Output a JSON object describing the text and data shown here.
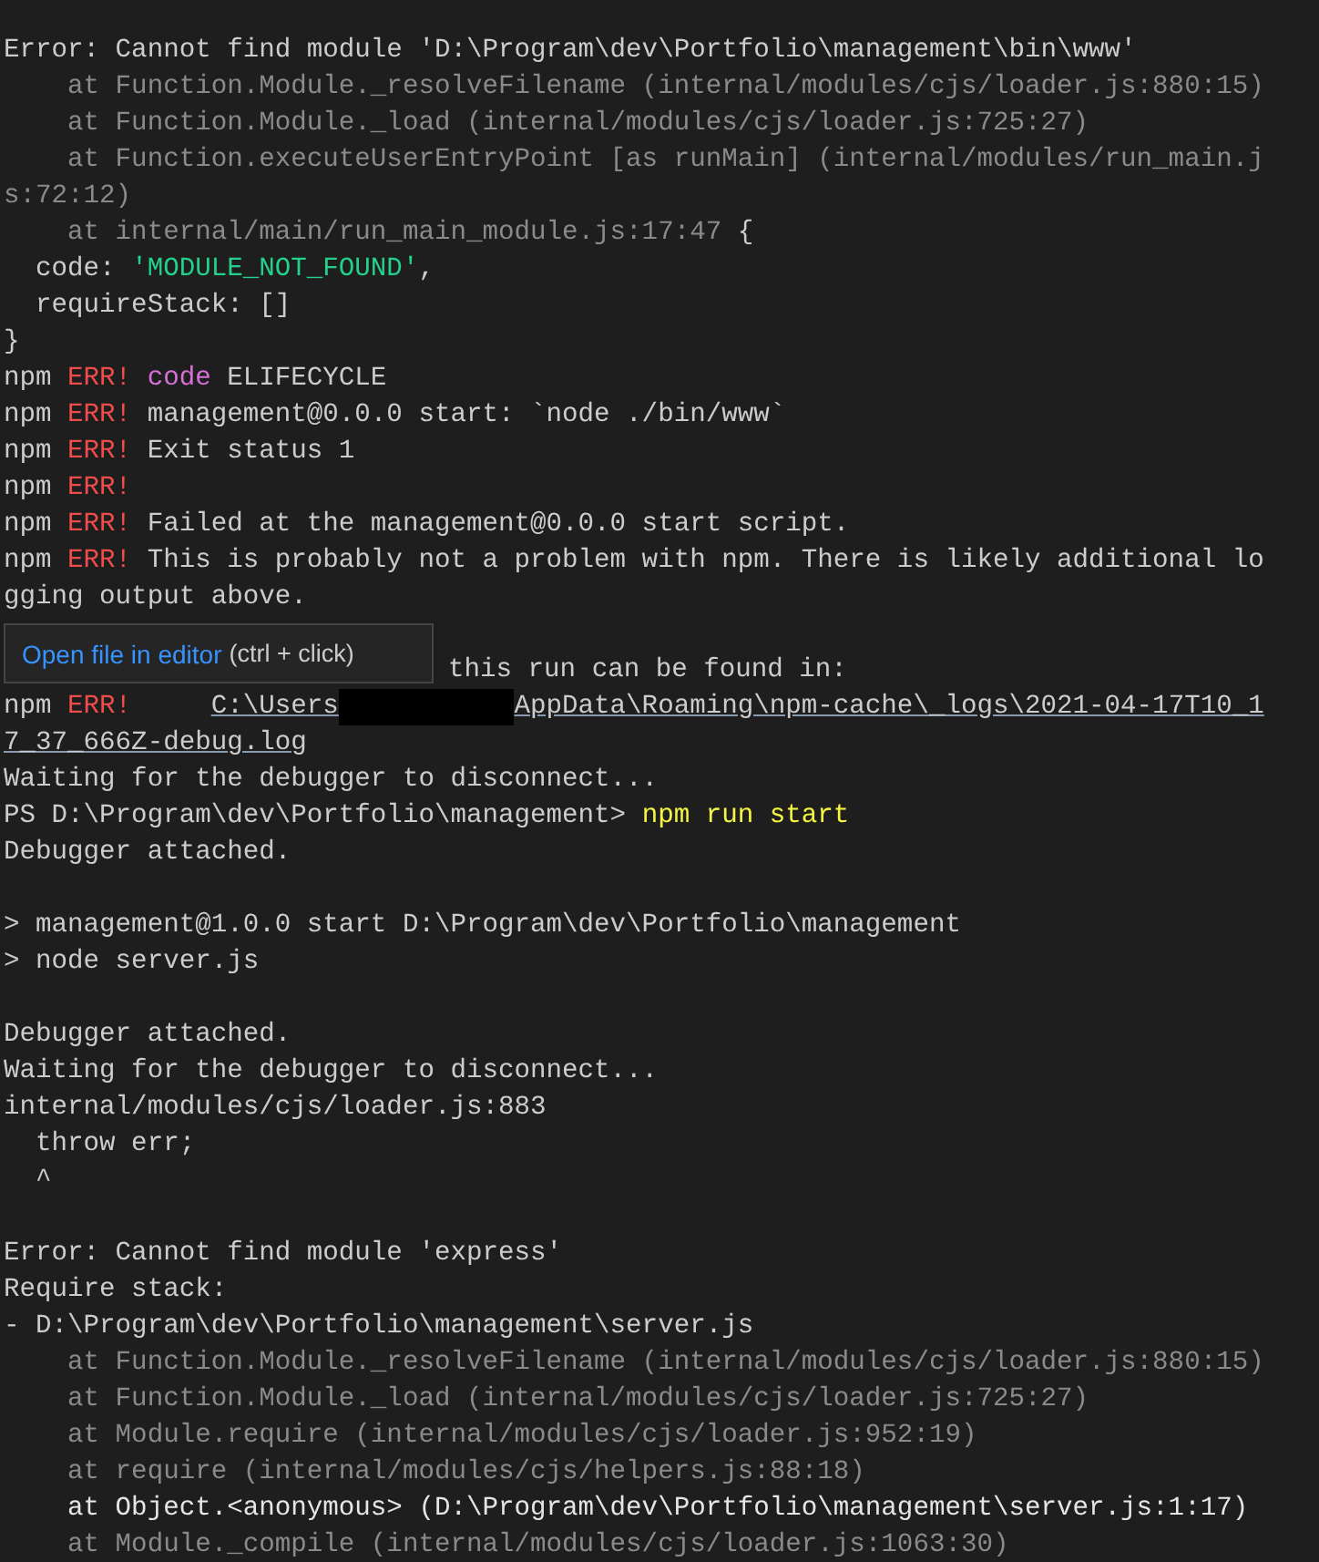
{
  "terminal": {
    "lines": [
      {
        "kind": "text",
        "segments": [
          {
            "kind": "normal",
            "text": "Error: Cannot find module 'D:\\Program\\dev\\Portfolio\\management\\bin\\www'"
          }
        ]
      },
      {
        "kind": "text",
        "segments": [
          {
            "kind": "dim",
            "text": "    at Function.Module._resolveFilename (internal/modules/cjs/loader.js:880:15)"
          }
        ]
      },
      {
        "kind": "text",
        "segments": [
          {
            "kind": "dim",
            "text": "    at Function.Module._load (internal/modules/cjs/loader.js:725:27)"
          }
        ]
      },
      {
        "kind": "text",
        "segments": [
          {
            "kind": "dim",
            "text": "    at Function.executeUserEntryPoint [as runMain] (internal/modules/run_main.j"
          }
        ]
      },
      {
        "kind": "text",
        "segments": [
          {
            "kind": "dim",
            "text": "s:72:12)"
          }
        ]
      },
      {
        "kind": "text",
        "segments": [
          {
            "kind": "dim",
            "text": "    at internal/main/run_main_module.js:17:47"
          },
          {
            "kind": "normal",
            "text": " {"
          }
        ]
      },
      {
        "kind": "text",
        "segments": [
          {
            "kind": "normal",
            "text": "  code: "
          },
          {
            "kind": "green",
            "text": "'MODULE_NOT_FOUND'"
          },
          {
            "kind": "normal",
            "text": ","
          }
        ]
      },
      {
        "kind": "text",
        "segments": [
          {
            "kind": "normal",
            "text": "  requireStack: []"
          }
        ]
      },
      {
        "kind": "text",
        "segments": [
          {
            "kind": "normal",
            "text": "}"
          }
        ]
      },
      {
        "kind": "text",
        "segments": [
          {
            "kind": "normal",
            "text": "npm "
          },
          {
            "kind": "red",
            "text": "ERR!"
          },
          {
            "kind": "magenta",
            "text": " code"
          },
          {
            "kind": "normal",
            "text": " ELIFECYCLE"
          }
        ]
      },
      {
        "kind": "text",
        "segments": [
          {
            "kind": "normal",
            "text": "npm "
          },
          {
            "kind": "red",
            "text": "ERR!"
          },
          {
            "kind": "normal",
            "text": " management@0.0.0 start: `node ./bin/www`"
          }
        ]
      },
      {
        "kind": "text",
        "segments": [
          {
            "kind": "normal",
            "text": "npm "
          },
          {
            "kind": "red",
            "text": "ERR!"
          },
          {
            "kind": "normal",
            "text": " Exit status 1"
          }
        ]
      },
      {
        "kind": "text",
        "segments": [
          {
            "kind": "normal",
            "text": "npm "
          },
          {
            "kind": "red",
            "text": "ERR!"
          }
        ]
      },
      {
        "kind": "text",
        "segments": [
          {
            "kind": "normal",
            "text": "npm "
          },
          {
            "kind": "red",
            "text": "ERR!"
          },
          {
            "kind": "normal",
            "text": " Failed at the management@0.0.0 start script."
          }
        ]
      },
      {
        "kind": "text",
        "segments": [
          {
            "kind": "normal",
            "text": "npm "
          },
          {
            "kind": "red",
            "text": "ERR!"
          },
          {
            "kind": "normal",
            "text": " This is probably not a problem with npm. There is likely additional lo"
          }
        ]
      },
      {
        "kind": "text",
        "segments": [
          {
            "kind": "normal",
            "text": "gging output above."
          }
        ]
      },
      {
        "kind": "blank"
      },
      {
        "kind": "tooltip",
        "tooltip": {
          "link": "Open file in editor",
          "hint": "(ctrl + click)"
        },
        "segments": [
          {
            "kind": "normal",
            "text": "this run can be found in:"
          }
        ]
      },
      {
        "kind": "text",
        "segments": [
          {
            "kind": "normal",
            "text": "npm "
          },
          {
            "kind": "red",
            "text": "ERR!     "
          },
          {
            "kind": "link",
            "text": "C:\\Users"
          },
          {
            "kind": "redacted"
          },
          {
            "kind": "link",
            "text": "AppData\\Roaming\\npm-cache\\_logs\\2021-04-17T10_1"
          }
        ]
      },
      {
        "kind": "text",
        "segments": [
          {
            "kind": "link",
            "text": "7_37_666Z-debug.log"
          }
        ]
      },
      {
        "kind": "text",
        "segments": [
          {
            "kind": "normal",
            "text": "Waiting for the debugger to disconnect..."
          }
        ]
      },
      {
        "kind": "text",
        "segments": [
          {
            "kind": "normal",
            "text": "PS D:\\Program\\dev\\Portfolio\\management> "
          },
          {
            "kind": "yellow",
            "text": "npm run start"
          }
        ]
      },
      {
        "kind": "text",
        "segments": [
          {
            "kind": "normal",
            "text": "Debugger attached."
          }
        ]
      },
      {
        "kind": "blank"
      },
      {
        "kind": "text",
        "segments": [
          {
            "kind": "normal",
            "text": "> management@1.0.0 start D:\\Program\\dev\\Portfolio\\management"
          }
        ]
      },
      {
        "kind": "text",
        "segments": [
          {
            "kind": "normal",
            "text": "> node server.js"
          }
        ]
      },
      {
        "kind": "blank"
      },
      {
        "kind": "text",
        "segments": [
          {
            "kind": "normal",
            "text": "Debugger attached."
          }
        ]
      },
      {
        "kind": "text",
        "segments": [
          {
            "kind": "normal",
            "text": "Waiting for the debugger to disconnect..."
          }
        ]
      },
      {
        "kind": "text",
        "segments": [
          {
            "kind": "normal",
            "text": "internal/modules/cjs/loader.js:883"
          }
        ]
      },
      {
        "kind": "text",
        "segments": [
          {
            "kind": "normal",
            "text": "  throw err;"
          }
        ]
      },
      {
        "kind": "text",
        "segments": [
          {
            "kind": "normal",
            "text": "  ^"
          }
        ]
      },
      {
        "kind": "blank"
      },
      {
        "kind": "text",
        "segments": [
          {
            "kind": "normal",
            "text": "Error: Cannot find module 'express'"
          }
        ]
      },
      {
        "kind": "text",
        "segments": [
          {
            "kind": "normal",
            "text": "Require stack:"
          }
        ]
      },
      {
        "kind": "text",
        "segments": [
          {
            "kind": "normal",
            "text": "- D:\\Program\\dev\\Portfolio\\management\\server.js"
          }
        ]
      },
      {
        "kind": "text",
        "segments": [
          {
            "kind": "dim",
            "text": "    at Function.Module._resolveFilename (internal/modules/cjs/loader.js:880:15)"
          }
        ]
      },
      {
        "kind": "text",
        "segments": [
          {
            "kind": "dim",
            "text": "    at Function.Module._load (internal/modules/cjs/loader.js:725:27)"
          }
        ]
      },
      {
        "kind": "text",
        "segments": [
          {
            "kind": "dim",
            "text": "    at Module.require (internal/modules/cjs/loader.js:952:19)"
          }
        ]
      },
      {
        "kind": "text",
        "segments": [
          {
            "kind": "dim",
            "text": "    at require (internal/modules/cjs/helpers.js:88:18)"
          }
        ]
      },
      {
        "kind": "text",
        "segments": [
          {
            "kind": "bright",
            "text": "    at Object.<anonymous> (D:\\Program\\dev\\Portfolio\\management\\server.js:1:17)"
          }
        ]
      },
      {
        "kind": "text",
        "segments": [
          {
            "kind": "dim",
            "text": "    at Module._compile (internal/modules/cjs/loader.js:1063:30)"
          }
        ]
      }
    ]
  }
}
